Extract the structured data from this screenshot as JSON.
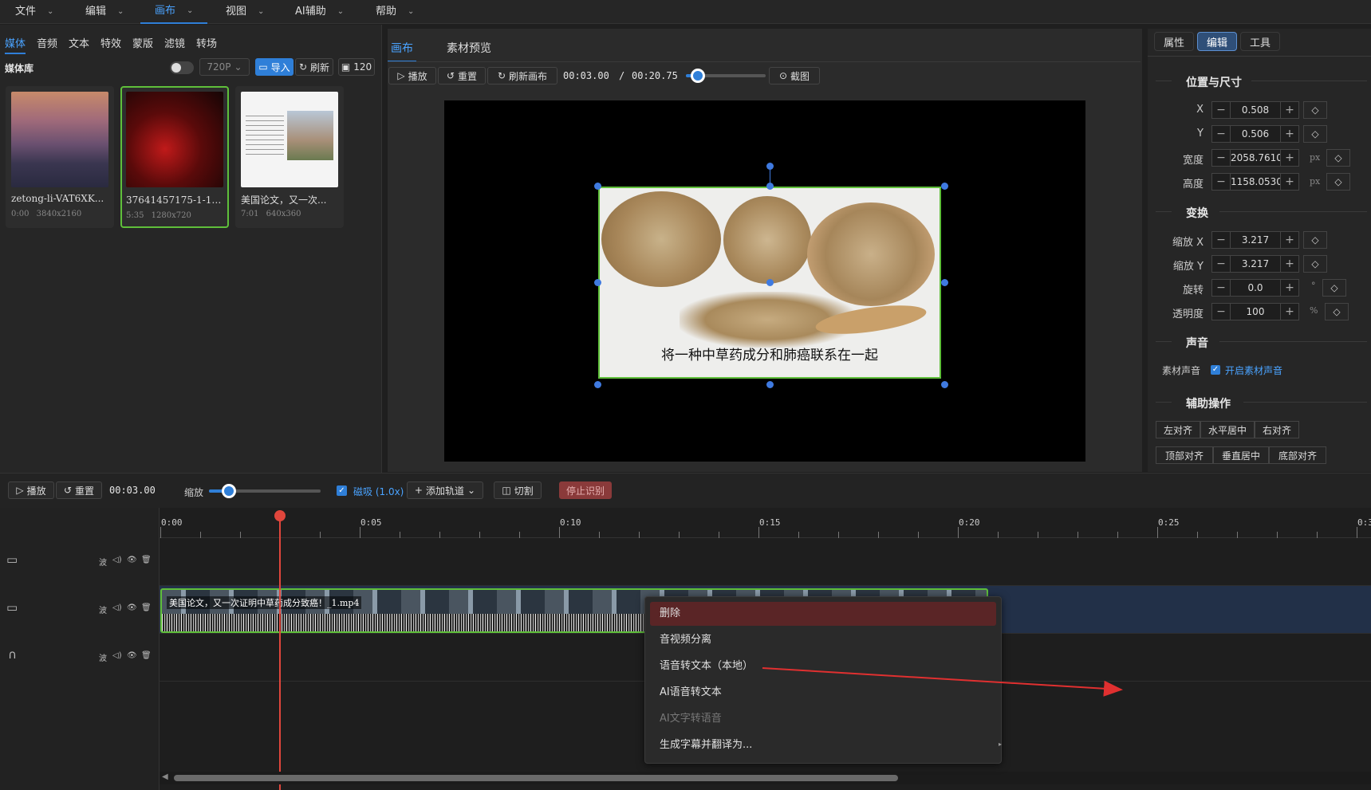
{
  "menubar": {
    "items": [
      {
        "label": "文件"
      },
      {
        "label": "编辑"
      },
      {
        "label": "画布"
      },
      {
        "label": "视图"
      },
      {
        "label": "AI辅助"
      },
      {
        "label": "帮助"
      }
    ],
    "active": "画布"
  },
  "left_panel": {
    "tabs": [
      "媒体",
      "音频",
      "文本",
      "特效",
      "蒙版",
      "滤镜",
      "转场"
    ],
    "active_tab": "媒体",
    "library_title": "媒体库",
    "toggle_on": false,
    "resolution_select": "720P",
    "import_label": "导入",
    "refresh_label": "刷新",
    "size_label": "120",
    "media": [
      {
        "name": "zetong-li-VAT6XK...",
        "duration": "0:00",
        "dims": "3840x2160"
      },
      {
        "name": "37641457175-1-192...",
        "duration": "5:35",
        "dims": "1280x720",
        "selected": true
      },
      {
        "name": "美国论文，又一次...",
        "duration": "7:01",
        "dims": "640x360"
      }
    ]
  },
  "preview": {
    "tabs": [
      "画布",
      "素材预览"
    ],
    "active_tab": "画布",
    "play_label": "播放",
    "reset_label": "重置",
    "refresh_canvas_label": "刷新画布",
    "time_current": "00:03.00",
    "time_separator": "/",
    "time_total": "00:20.75",
    "progress": 0.15,
    "screenshot_label": "截图",
    "subtitle": "将一种中草药成分和肺癌联系在一起"
  },
  "properties": {
    "tabs": [
      "属性",
      "编辑",
      "工具"
    ],
    "active_tab": "编辑",
    "position_size_title": "位置与尺寸",
    "fields_pos": [
      {
        "label": "X",
        "value": "0.508",
        "unit": ""
      },
      {
        "label": "Y",
        "value": "0.506",
        "unit": ""
      },
      {
        "label": "宽度",
        "value": "2058.76100",
        "unit": "px"
      },
      {
        "label": "高度",
        "value": "1158.05300",
        "unit": "px"
      }
    ],
    "transform_title": "变换",
    "fields_transform": [
      {
        "label": "缩放 X",
        "value": "3.217",
        "unit": ""
      },
      {
        "label": "缩放 Y",
        "value": "3.217",
        "unit": ""
      },
      {
        "label": "旋转",
        "value": "0.0",
        "unit": "°"
      },
      {
        "label": "透明度",
        "value": "100",
        "unit": "%"
      }
    ],
    "audio_title": "声音",
    "source_audio_label": "素材声音",
    "enable_audio_label": "开启素材声音",
    "enable_audio_checked": true,
    "aux_title": "辅助操作",
    "align_row1": [
      "左对齐",
      "水平居中",
      "右对齐"
    ],
    "align_row2": [
      "顶部对齐",
      "垂直居中",
      "底部对齐"
    ]
  },
  "timeline_toolbar": {
    "play_label": "播放",
    "reset_label": "重置",
    "time": "00:03.00",
    "zoom_label": "缩放",
    "zoom_level": 0.18,
    "snap_label": "磁吸 (1.0x)",
    "snap_checked": true,
    "add_track_label": "添加轨道",
    "cut_label": "切割",
    "stop_recognition_label": "停止识别"
  },
  "timeline": {
    "ticks": [
      "0:00",
      "0:05",
      "0:10",
      "0:15",
      "0:20",
      "0:25",
      "0:3"
    ],
    "playhead_seconds": 3.0,
    "track_controls": [
      "波",
      "◁)",
      "👁",
      "🗑"
    ],
    "clip_label": "美国论文，又一次证明中草药成分致癌！_1.mp4",
    "clip_duration_seconds": 20.75
  },
  "context_menu": {
    "items": [
      {
        "label": "删除",
        "highlighted": true,
        "disabled": false
      },
      {
        "label": "音视频分离",
        "highlighted": false,
        "disabled": false
      },
      {
        "label": "语音转文本（本地）",
        "highlighted": false,
        "disabled": false
      },
      {
        "label": "AI语音转文本",
        "highlighted": false,
        "disabled": false
      },
      {
        "label": "AI文字转语音",
        "highlighted": false,
        "disabled": true
      },
      {
        "label": "生成字幕并翻译为...",
        "highlighted": false,
        "disabled": false
      }
    ],
    "submenu_arrow": "▸"
  },
  "colors": {
    "accent": "#2f7fd8",
    "selection_green": "#5fbf3a",
    "playhead_red": "#e0463c",
    "annotation_arrow": "#e03030",
    "stop_button": "#8a3a3a"
  }
}
